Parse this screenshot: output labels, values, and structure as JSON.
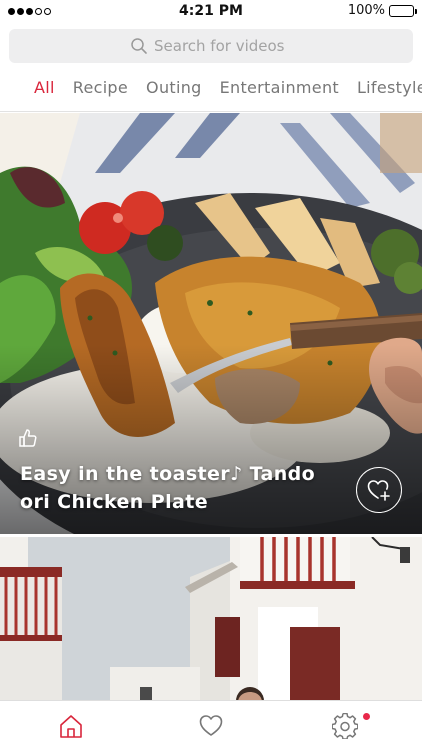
{
  "status_bar": {
    "time": "4:21 PM",
    "battery": "100%",
    "signal_icon": "signal-dots-icon",
    "battery_icon": "battery-icon"
  },
  "search": {
    "placeholder": "Search for videos",
    "icon": "search-icon"
  },
  "tabs": [
    {
      "label": "All",
      "active": true
    },
    {
      "label": "Recipe",
      "active": false
    },
    {
      "label": "Outing",
      "active": false
    },
    {
      "label": "Entertainment",
      "active": false
    },
    {
      "label": "Lifestyle",
      "active": false
    }
  ],
  "featured": {
    "title": "Easy in the toaster♪ Tandoori Chicken Plate",
    "title_line1": "Easy in the toaster♪ Tando",
    "title_line2": "ori Chicken Plate",
    "like_icon": "thumbs-up-icon",
    "favorite_icon": "heart-plus-icon"
  },
  "bottom_nav": {
    "items": [
      {
        "icon": "home-icon",
        "active": true
      },
      {
        "icon": "heart-icon",
        "active": false
      },
      {
        "icon": "gear-icon",
        "active": false,
        "badge": true
      }
    ]
  },
  "colors": {
    "accent": "#d9263c",
    "badge": "#e8284a",
    "tab_inactive": "#777777",
    "search_bg": "#eeeeef"
  }
}
